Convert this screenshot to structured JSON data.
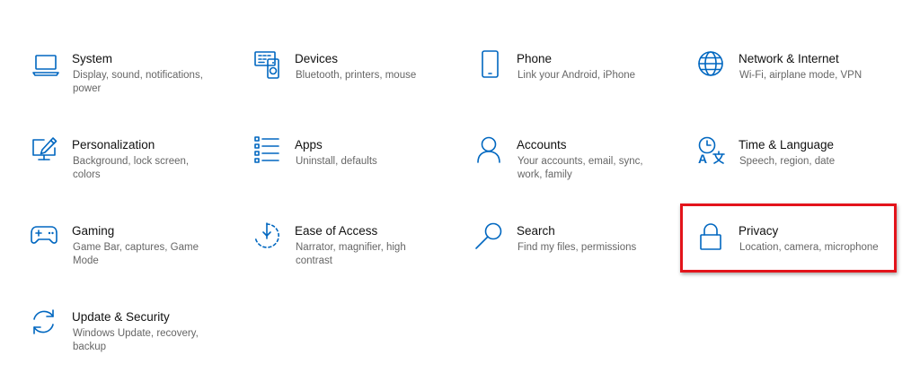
{
  "accent_color": "#0067c0",
  "highlight_color": "#e3141b",
  "tiles": [
    {
      "title": "System",
      "desc": "Display, sound, notifications, power",
      "icon": "laptop-icon"
    },
    {
      "title": "Devices",
      "desc": "Bluetooth, printers, mouse",
      "icon": "devices-icon"
    },
    {
      "title": "Phone",
      "desc": "Link your Android, iPhone",
      "icon": "phone-icon"
    },
    {
      "title": "Network & Internet",
      "desc": "Wi-Fi, airplane mode, VPN",
      "icon": "globe-icon"
    },
    {
      "title": "Personalization",
      "desc": "Background, lock screen, colors",
      "icon": "paint-monitor-icon"
    },
    {
      "title": "Apps",
      "desc": "Uninstall, defaults",
      "icon": "apps-list-icon"
    },
    {
      "title": "Accounts",
      "desc": "Your accounts, email, sync, work, family",
      "icon": "person-icon"
    },
    {
      "title": "Time & Language",
      "desc": "Speech, region, date",
      "icon": "time-language-icon"
    },
    {
      "title": "Gaming",
      "desc": "Game Bar, captures, Game Mode",
      "icon": "gamepad-icon"
    },
    {
      "title": "Ease of Access",
      "desc": "Narrator, magnifier, high contrast",
      "icon": "ease-of-access-icon"
    },
    {
      "title": "Search",
      "desc": "Find my files, permissions",
      "icon": "search-icon"
    },
    {
      "title": "Privacy",
      "desc": "Location, camera, microphone",
      "icon": "lock-icon"
    },
    {
      "title": "Update & Security",
      "desc": "Windows Update, recovery, backup",
      "icon": "sync-arrows-icon"
    }
  ]
}
